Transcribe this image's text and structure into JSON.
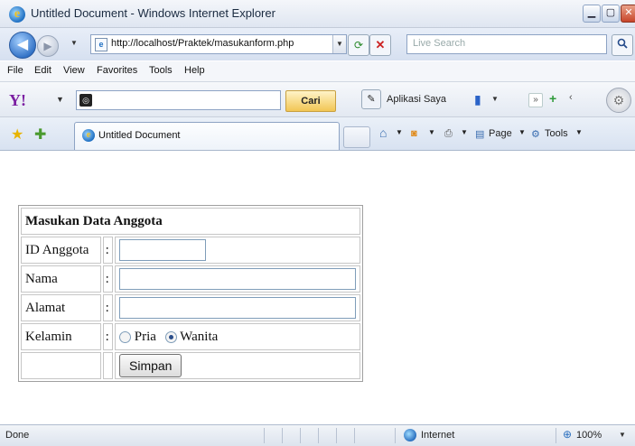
{
  "window": {
    "title": "Untitled Document - Windows Internet Explorer"
  },
  "address": {
    "url": "http://localhost/Praktek/masukanform.php",
    "search_placeholder": "Live Search"
  },
  "menu": [
    "File",
    "Edit",
    "View",
    "Favorites",
    "Tools",
    "Help"
  ],
  "yahoo": {
    "search_value": "",
    "search_button": "Cari",
    "aplikasi_label": "Aplikasi Saya"
  },
  "tab": {
    "label": "Untitled Document"
  },
  "commands": {
    "page": "Page",
    "tools": "Tools"
  },
  "form": {
    "title": "Masukan Data Anggota",
    "colon": ":",
    "labels": {
      "id": "ID Anggota",
      "nama": "Nama",
      "alamat": "Alamat",
      "kelamin": "Kelamin"
    },
    "values": {
      "id": "",
      "nama": "",
      "alamat": ""
    },
    "gender_options": [
      "Pria",
      "Wanita"
    ],
    "gender_selected": "Wanita",
    "submit_label": "Simpan"
  },
  "status": {
    "text": "Done",
    "zone": "Internet",
    "zoom": "100%"
  }
}
